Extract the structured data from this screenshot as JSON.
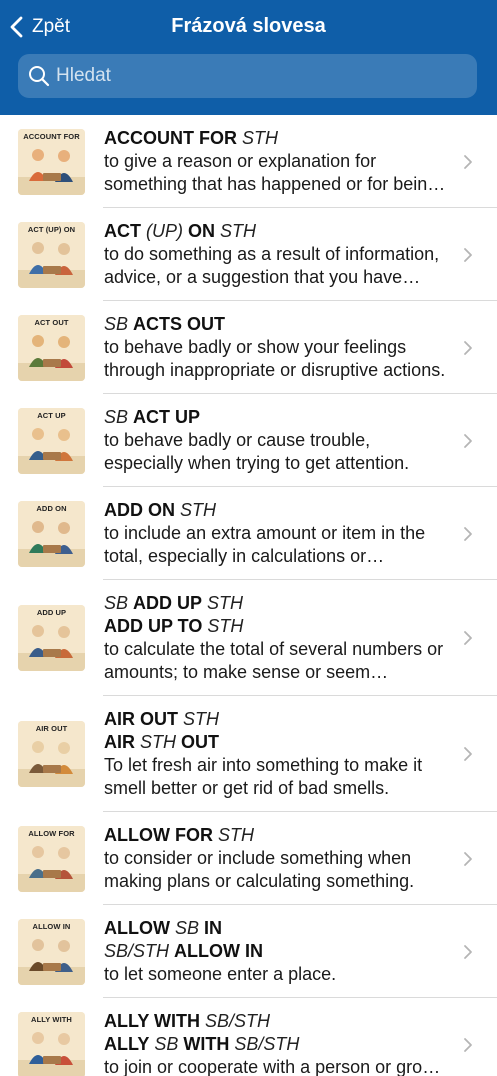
{
  "header": {
    "back_label": "Zpět",
    "title": "Frázová slovesa",
    "search_placeholder": "Hledat"
  },
  "colors": {
    "header_bg": "#0f5ea8",
    "divider": "#dadada",
    "chevron": "#b5b5b5"
  },
  "items": [
    {
      "image_label": "ACCOUNT FOR",
      "image_icon": "two-people-explaining-illustration",
      "lines": [
        [
          {
            "t": "ACCOUNT FOR",
            "s": "b"
          },
          {
            "t": " STH",
            "s": "i"
          }
        ]
      ],
      "definition": "to give a reason or explanation for something that has happened or for being responsible for something."
    },
    {
      "image_label": "ACT (UP) ON",
      "image_icon": "people-reading-information-illustration",
      "lines": [
        [
          {
            "t": "ACT",
            "s": "b"
          },
          {
            "t": " (UP) ",
            "s": "i"
          },
          {
            "t": "ON",
            "s": "b"
          },
          {
            "t": " STH",
            "s": "i"
          }
        ]
      ],
      "definition": "to do something as a result of information, advice, or a suggestion that you have received."
    },
    {
      "image_label": "ACT OUT",
      "image_icon": "children-misbehaving-classroom-illustration",
      "lines": [
        [
          {
            "t": "SB ",
            "s": "i"
          },
          {
            "t": "ACTS OUT",
            "s": "b"
          }
        ]
      ],
      "definition": "to behave badly or show your feelings through inappropriate or disruptive actions."
    },
    {
      "image_label": "ACT UP",
      "image_icon": "child-causing-trouble-illustration",
      "lines": [
        [
          {
            "t": "SB ",
            "s": "i"
          },
          {
            "t": "ACT UP",
            "s": "b"
          }
        ]
      ],
      "definition": "to behave badly or cause trouble, especially when trying to get attention."
    },
    {
      "image_label": "ADD ON",
      "image_icon": "person-calculating-total-illustration",
      "lines": [
        [
          {
            "t": "ADD ON",
            "s": "b"
          },
          {
            "t": " STH",
            "s": "i"
          }
        ]
      ],
      "definition": "to include an extra amount or item in the total, especially in calculations or payments."
    },
    {
      "image_label": "ADD UP",
      "image_icon": "addition-numbers-illustration",
      "lines": [
        [
          {
            "t": "SB ",
            "s": "i"
          },
          {
            "t": "ADD UP",
            "s": "b"
          },
          {
            "t": " STH",
            "s": "i"
          }
        ],
        [
          {
            "t": "ADD UP TO",
            "s": "b"
          },
          {
            "t": " STH",
            "s": "i"
          }
        ]
      ],
      "definition": "to calculate the total of several numbers or amounts; to make sense or seem reasonable."
    },
    {
      "image_label": "AIR OUT",
      "image_icon": "opening-window-room-illustration",
      "lines": [
        [
          {
            "t": "AIR OUT",
            "s": "b"
          },
          {
            "t": " STH",
            "s": "i"
          }
        ],
        [
          {
            "t": "AIR",
            "s": "b"
          },
          {
            "t": " STH ",
            "s": "i"
          },
          {
            "t": "OUT",
            "s": "b"
          }
        ]
      ],
      "definition": "To let fresh air into something to make it smell better or get rid of bad smells."
    },
    {
      "image_label": "ALLOW FOR",
      "image_icon": "people-planning-at-table-illustration",
      "lines": [
        [
          {
            "t": "ALLOW FOR",
            "s": "b"
          },
          {
            "t": " STH",
            "s": "i"
          }
        ]
      ],
      "definition": "to consider or include something when making plans or calculating something."
    },
    {
      "image_label": "ALLOW IN",
      "image_icon": "person-letting-guest-in-door-illustration",
      "lines": [
        [
          {
            "t": "ALLOW",
            "s": "b"
          },
          {
            "t": " SB ",
            "s": "i"
          },
          {
            "t": "IN",
            "s": "b"
          }
        ],
        [
          {
            "t": "SB/STH ",
            "s": "i"
          },
          {
            "t": "ALLOW IN",
            "s": "b"
          }
        ]
      ],
      "definition": "to let someone enter a place."
    },
    {
      "image_label": "ALLY WITH",
      "image_icon": "two-people-shaking-hands-illustration",
      "lines": [
        [
          {
            "t": "ALLY WITH",
            "s": "b"
          },
          {
            "t": " SB/STH",
            "s": "i"
          }
        ],
        [
          {
            "t": "ALLY",
            "s": "b"
          },
          {
            "t": " SB ",
            "s": "i"
          },
          {
            "t": "WITH",
            "s": "b"
          },
          {
            "t": " SB/STH",
            "s": "i"
          }
        ]
      ],
      "definition": "to join or cooperate with a person or group in order to achieve something."
    }
  ]
}
